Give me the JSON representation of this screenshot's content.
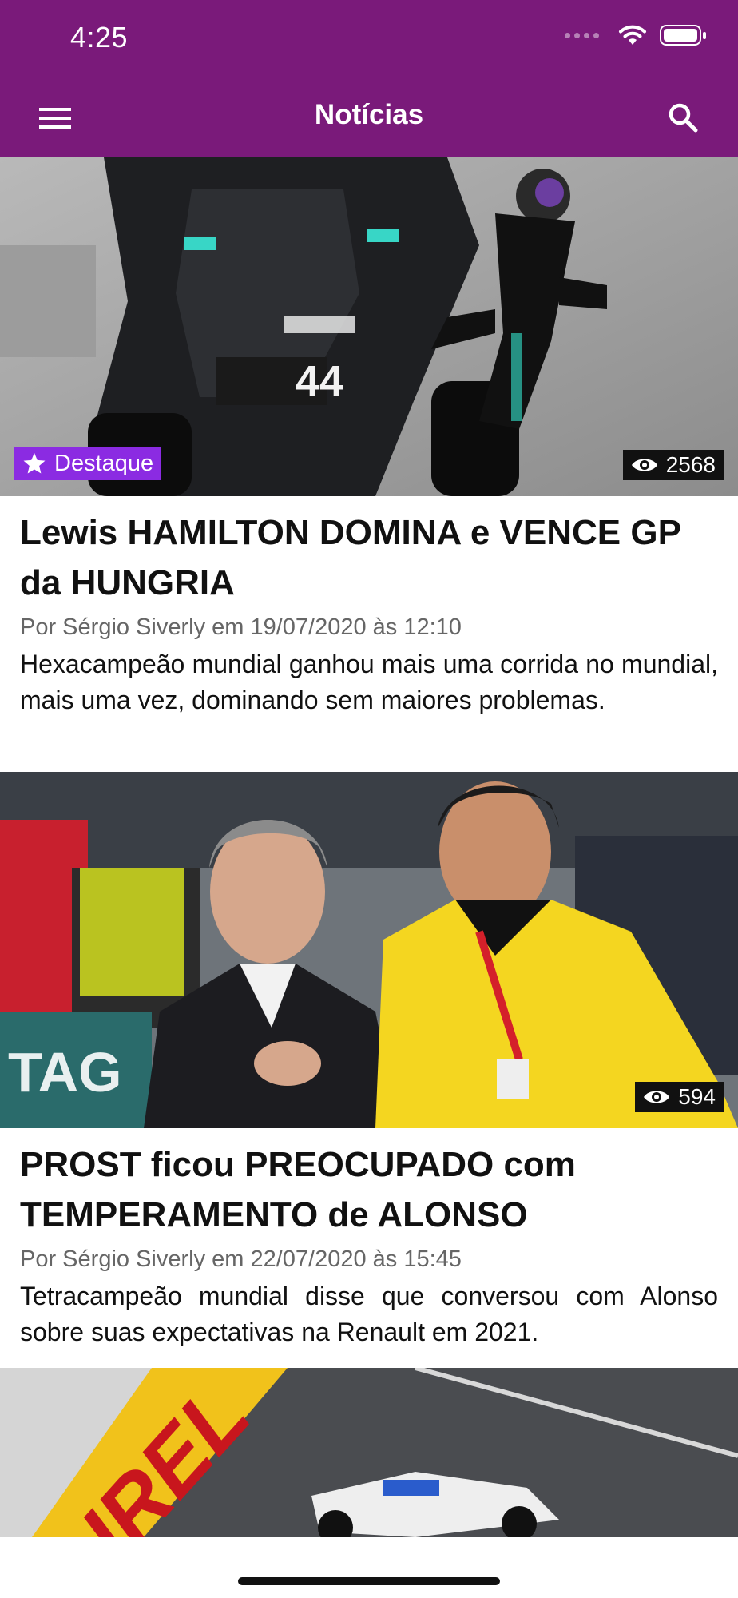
{
  "status_bar": {
    "time": "4:25"
  },
  "header": {
    "title": "Notícias"
  },
  "icons": {
    "menu": "hamburger-menu-icon",
    "search": "search-icon",
    "star": "star-icon",
    "views": "eye-icon",
    "wifi": "wifi-icon",
    "battery": "battery-icon"
  },
  "colors": {
    "header_bg": "#7a1a7a",
    "featured_badge": "#8b2be2",
    "views_badge": "#111111"
  },
  "articles": [
    {
      "badge": "Destaque",
      "views": "2568",
      "title": "Lewis HAMILTON DOMINA e VENCE GP da HUNGRIA",
      "meta": "Por Sérgio Siverly em 19/07/2020 às 12:10",
      "summary": "Hexacampeão mundial ganhou mais uma corrida no mundial, mais uma vez, dominando sem maiores problemas."
    },
    {
      "views": "594",
      "title": "PROST ficou PREOCUPADO com TEMPERAMENTO de ALONSO",
      "meta": "Por Sérgio Siverly em 22/07/2020 às 15:45",
      "summary": "Tetracampeão mundial disse que conversou com Alonso sobre suas expectativas na Renault em 2021."
    },
    {
      "image_text": "IREL"
    }
  ]
}
